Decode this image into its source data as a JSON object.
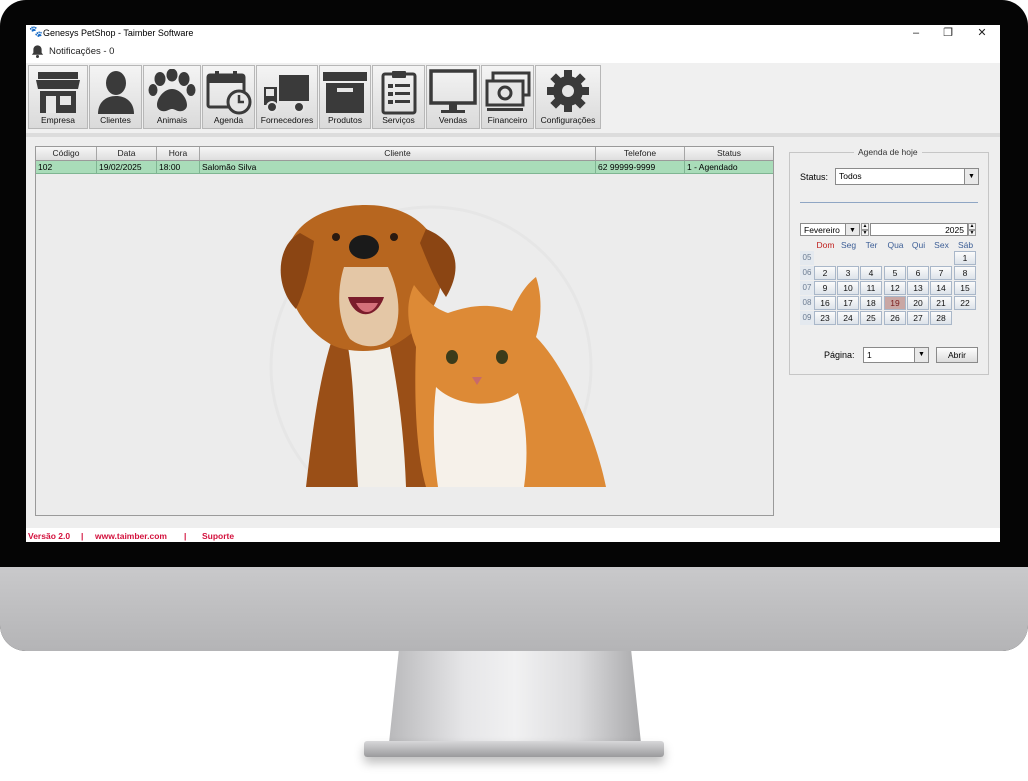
{
  "window": {
    "title": "Genesys PetShop - Taimber Software",
    "minimize_glyph": "–",
    "maximize_glyph": "❐",
    "close_glyph": "✕"
  },
  "notifications": {
    "label": "Notificações - 0",
    "icon": "bell-icon"
  },
  "toolbar": {
    "items": [
      {
        "label": "Empresa",
        "icon": "store-icon"
      },
      {
        "label": "Clientes",
        "icon": "person-icon"
      },
      {
        "label": "Animais",
        "icon": "paw-icon"
      },
      {
        "label": "Agenda",
        "icon": "calendar-clock-icon"
      },
      {
        "label": "Fornecedores",
        "icon": "truck-icon"
      },
      {
        "label": "Produtos",
        "icon": "box-icon"
      },
      {
        "label": "Serviços",
        "icon": "clipboard-icon"
      },
      {
        "label": "Vendas",
        "icon": "monitor-icon"
      },
      {
        "label": "Financeiro",
        "icon": "money-icon"
      },
      {
        "label": "Configurações",
        "icon": "gear-icon"
      }
    ]
  },
  "table": {
    "columns": [
      "Código",
      "Data",
      "Hora",
      "Cliente",
      "Telefone",
      "Status"
    ],
    "rows": [
      [
        "102",
        "19/02/2025",
        "18:00",
        "Salomão Silva",
        "62 99999-9999",
        "1 - Agendado"
      ]
    ],
    "selected_row_color": "#a9dcb9"
  },
  "agenda": {
    "title": "Agenda de hoje",
    "status_label": "Status:",
    "status_value": "Todos",
    "month": "Fevereiro",
    "year": "2025",
    "weekdays": [
      "Dom",
      "Seg",
      "Ter",
      "Qua",
      "Qui",
      "Sex",
      "Sáb"
    ],
    "weeks": [
      {
        "week": "05",
        "days": [
          "",
          "",
          "",
          "",
          "",
          "",
          "1"
        ]
      },
      {
        "week": "06",
        "days": [
          "2",
          "3",
          "4",
          "5",
          "6",
          "7",
          "8"
        ]
      },
      {
        "week": "07",
        "days": [
          "9",
          "10",
          "11",
          "12",
          "13",
          "14",
          "15"
        ]
      },
      {
        "week": "08",
        "days": [
          "16",
          "17",
          "18",
          "19",
          "20",
          "21",
          "22"
        ]
      },
      {
        "week": "09",
        "days": [
          "23",
          "24",
          "25",
          "26",
          "27",
          "28",
          ""
        ]
      }
    ],
    "today": "19",
    "page_label": "Página:",
    "page_value": "1",
    "open_button": "Abrir"
  },
  "footer": {
    "version": "Versão 2.0",
    "sep1": "|",
    "website": "www.taimber.com",
    "sep2": "|",
    "support": "Suporte"
  },
  "colors": {
    "footer_text": "#d3113d",
    "accent_blue": "#3c5e96",
    "today_cell": "#c9a7a4"
  }
}
